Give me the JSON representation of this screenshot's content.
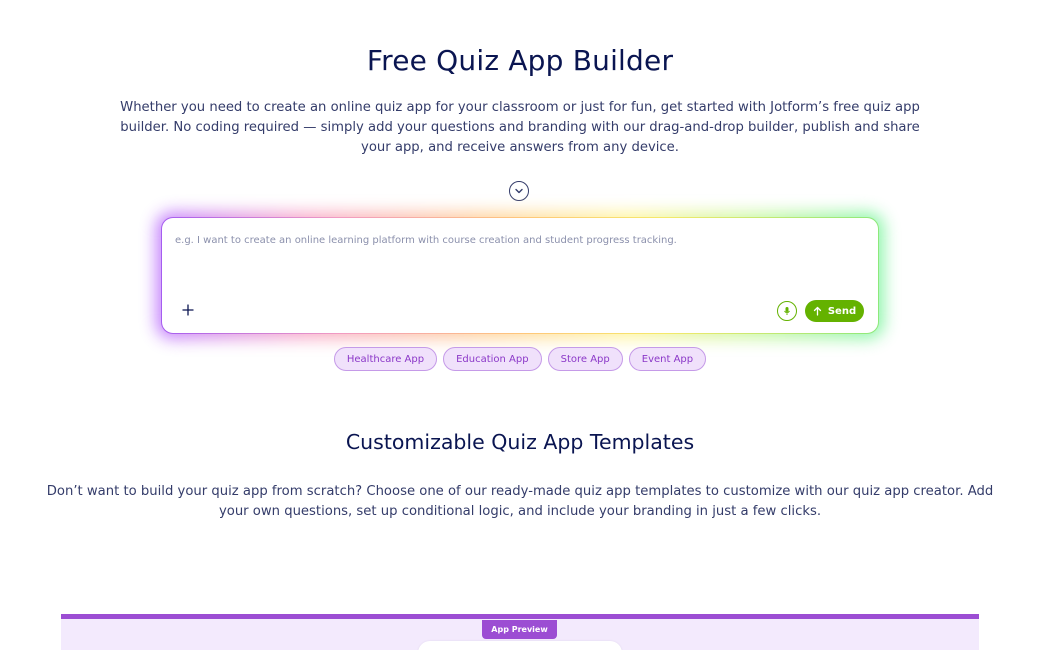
{
  "hero": {
    "title": "Free Quiz App Builder",
    "description": "Whether you need to create an online quiz app for your classroom or just for fun, get started with Jotform’s free quiz app builder. No coding required — simply add your questions and branding with our drag-and-drop builder, publish and share your app, and receive answers from any device.",
    "scroll_icon": "chevron-down-icon"
  },
  "prompt": {
    "placeholder": "e.g. I want to create an online learning platform with course creation and student progress tracking.",
    "value": "",
    "add_icon": "plus-icon",
    "mic_icon": "microphone-icon",
    "send_icon": "arrow-up-icon",
    "send_label": "Send",
    "accent_color": "#64b200"
  },
  "chips": [
    {
      "label": "Healthcare App"
    },
    {
      "label": "Education App"
    },
    {
      "label": "Store App"
    },
    {
      "label": "Event App"
    }
  ],
  "templates": {
    "title": "Customizable Quiz App Templates",
    "description": "Don’t want to build your quiz app from scratch? Choose one of our ready-made quiz app templates to customize with our quiz app creator. Add your own questions, set up conditional logic, and include your branding in just a few clicks."
  },
  "preview": {
    "tab_label": "App Preview",
    "accent_color": "#9c4dd3"
  }
}
